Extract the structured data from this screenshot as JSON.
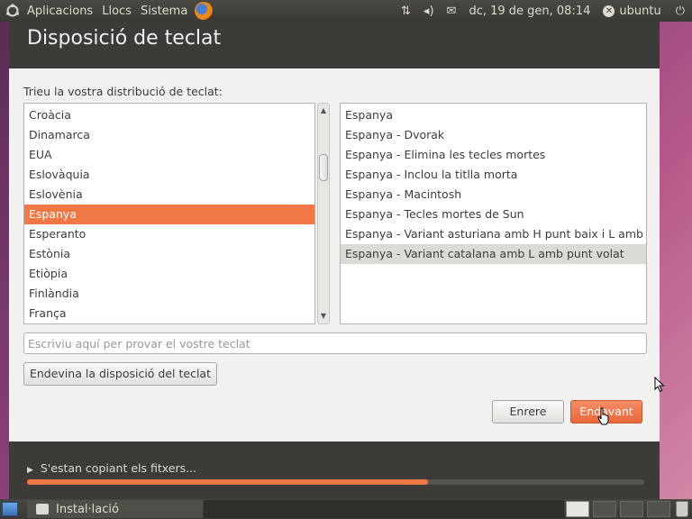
{
  "top_panel": {
    "menus": [
      "Aplicacions",
      "Llocs",
      "Sistema"
    ],
    "network_icon": "network-arrows-icon",
    "volume_icon": "speaker-icon",
    "mail_icon": "envelope-icon",
    "clock": "dc, 19 de gen, 08:14",
    "user": "ubuntu"
  },
  "window": {
    "title": "Disposició de teclat",
    "prompt": "Trieu la vostra distribució de teclat:",
    "layouts": [
      "Croàcia",
      "Dinamarca",
      "EUA",
      "Eslovàquia",
      "Eslovènia",
      "Espanya",
      "Esperanto",
      "Estònia",
      "Etiòpia",
      "Finlàndia",
      "França"
    ],
    "selected_layout_index": 5,
    "variants": [
      "Espanya",
      "Espanya - Dvorak",
      "Espanya - Elimina les tecles mortes",
      "Espanya - Inclou la titlla morta",
      "Espanya - Macintosh",
      "Espanya - Tecles mortes de Sun",
      "Espanya - Variant asturiana amb H punt baix i L amb",
      "Espanya - Variant catalana amb L amb punt volat"
    ],
    "selected_variant_index": 7,
    "test_placeholder": "Escriviu aquí per provar el vostre teclat",
    "guess_button": "Endevina la disposició del teclat",
    "back_button": "Enrere",
    "forward_button": "Endavant"
  },
  "progress": {
    "status": "S'estan copiant els fitxers...",
    "fraction": 0.65
  },
  "bottom_panel": {
    "task": "Instal·lació"
  },
  "colors": {
    "accent": "#f07746",
    "panel": "#3c3b37"
  }
}
